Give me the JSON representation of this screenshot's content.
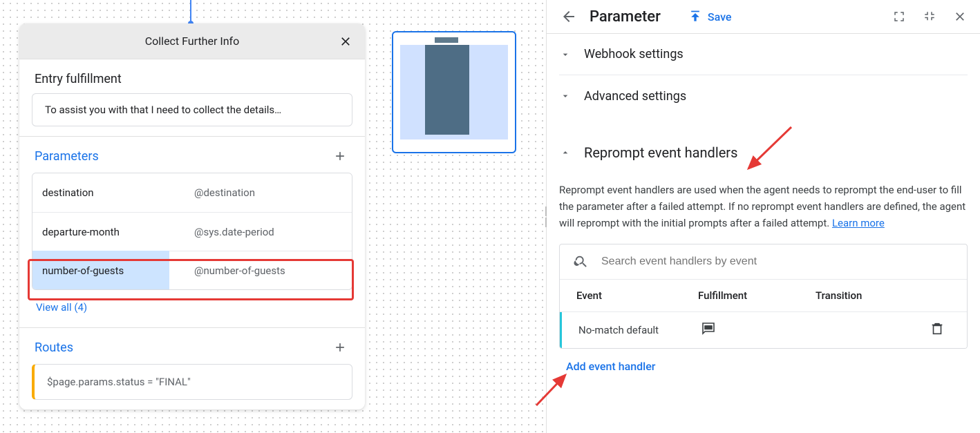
{
  "canvas": {
    "page_title": "Collect Further Info",
    "entry_title": "Entry fulfillment",
    "entry_text": "To assist you with that I need to collect the details…",
    "parameters_title": "Parameters",
    "params": [
      {
        "name": "destination",
        "type": "@destination"
      },
      {
        "name": "departure-month",
        "type": "@sys.date-period"
      },
      {
        "name": "number-of-guests",
        "type": "@number-of-guests"
      }
    ],
    "view_all": "View all (4)",
    "routes_title": "Routes",
    "route_condition": "$page.params.status = \"FINAL\""
  },
  "right": {
    "title": "Parameter",
    "save": "Save",
    "sections": {
      "webhook": "Webhook settings",
      "advanced": "Advanced settings"
    },
    "reprompt": {
      "title": "Reprompt event handlers",
      "description": "Reprompt event handlers are used when the agent needs to reprompt the end-user to fill the parameter after a failed attempt. If no reprompt event handlers are defined, the agent will reprompt with the initial prompts after a failed attempt. ",
      "learn_more": "Learn more",
      "search_placeholder": "Search event handlers by event",
      "columns": {
        "event": "Event",
        "fulfillment": "Fulfillment",
        "transition": "Transition"
      },
      "rows": [
        {
          "event": "No-match default"
        }
      ],
      "add_label": "Add event handler"
    }
  }
}
